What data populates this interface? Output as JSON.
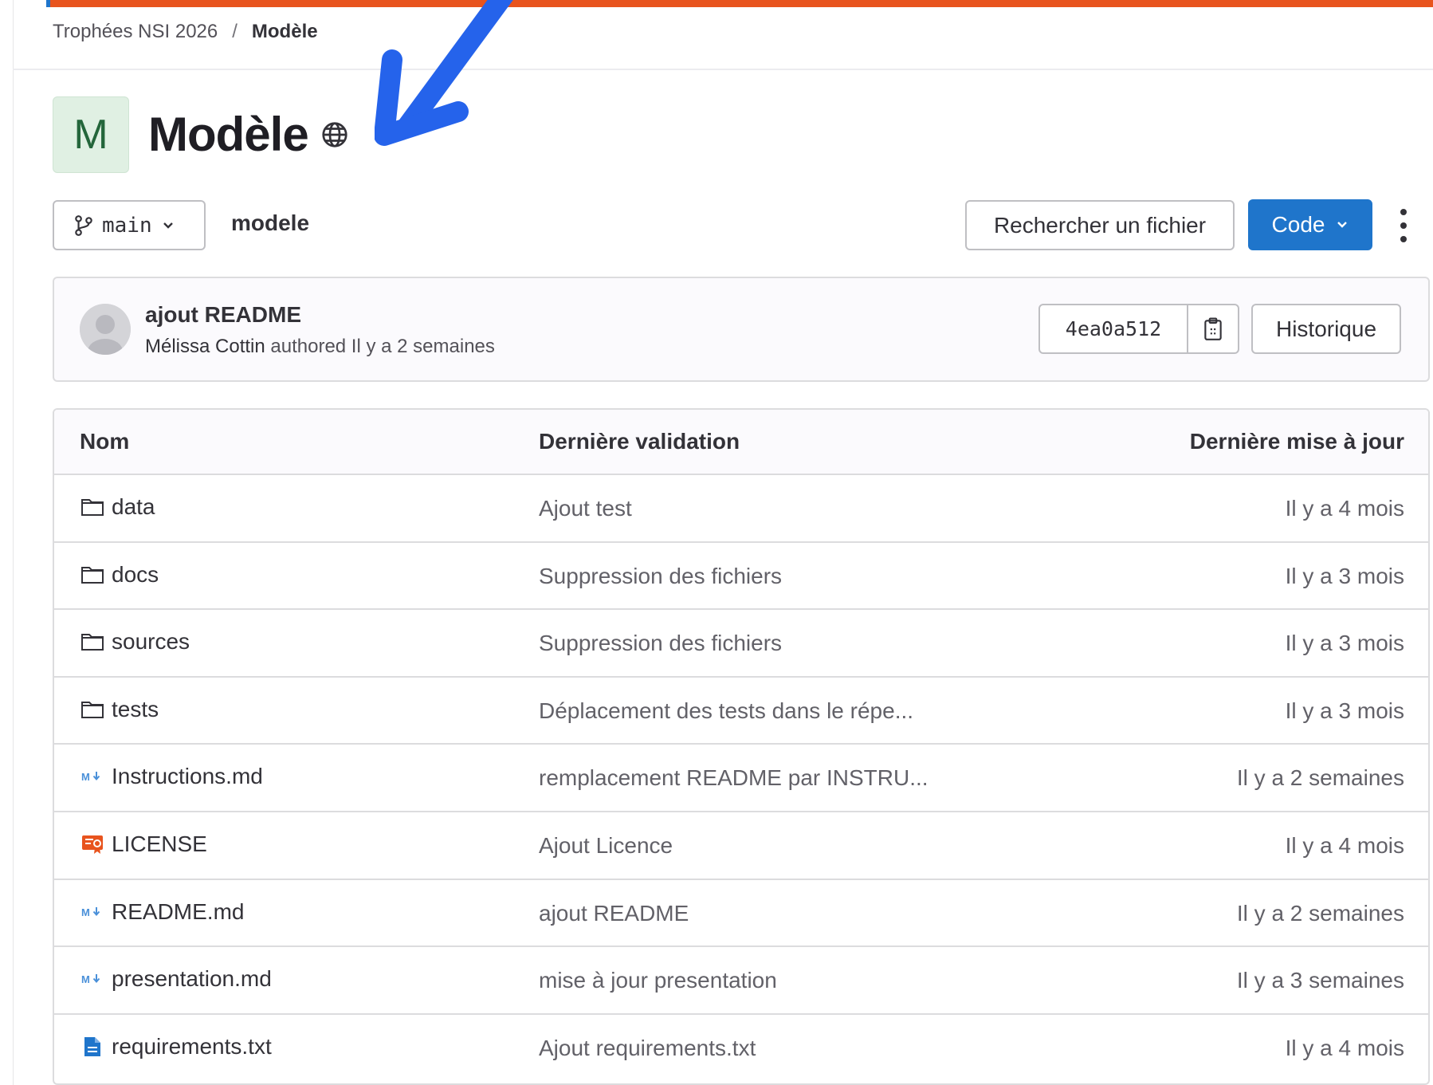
{
  "breadcrumb": {
    "group": "Trophées NSI 2026",
    "separator": "/",
    "current": "Modèle"
  },
  "project": {
    "avatar_letter": "M",
    "title": "Modèle",
    "visibility_icon": "globe-icon"
  },
  "toolbar": {
    "branch": "main",
    "repo_name": "modele",
    "find_file": "Rechercher un fichier",
    "code": "Code"
  },
  "last_commit": {
    "title": "ajout README",
    "author": "Mélissa Cottin",
    "meta": " authored Il y a 2 semaines",
    "sha": "4ea0a512",
    "history": "Historique"
  },
  "table": {
    "headers": {
      "name": "Nom",
      "commit": "Dernière validation",
      "date": "Dernière mise à jour"
    },
    "rows": [
      {
        "icon": "folder-icon",
        "name": "data",
        "commit": "Ajout test",
        "date": "Il y a 4 mois"
      },
      {
        "icon": "folder-icon",
        "name": "docs",
        "commit": "Suppression des fichiers",
        "date": "Il y a 3 mois"
      },
      {
        "icon": "folder-icon",
        "name": "sources",
        "commit": "Suppression des fichiers",
        "date": "Il y a 3 mois"
      },
      {
        "icon": "folder-icon",
        "name": "tests",
        "commit": "Déplacement des tests dans le répe...",
        "date": "Il y a 3 mois"
      },
      {
        "icon": "markdown-icon",
        "name": "Instructions.md",
        "commit": "remplacement README par INSTRU...",
        "date": "Il y a 2 semaines"
      },
      {
        "icon": "license-icon",
        "name": "LICENSE",
        "commit": "Ajout Licence",
        "date": "Il y a 4 mois"
      },
      {
        "icon": "markdown-icon",
        "name": "README.md",
        "commit": "ajout README",
        "date": "Il y a 2 semaines"
      },
      {
        "icon": "markdown-icon",
        "name": "presentation.md",
        "commit": "mise à jour presentation",
        "date": "Il y a 3 semaines"
      },
      {
        "icon": "text-file-icon",
        "name": "requirements.txt",
        "commit": "Ajout requirements.txt",
        "date": "Il y a 4 mois"
      }
    ]
  },
  "colors": {
    "accent": "#1f75cb",
    "top_bar": "#e8541e",
    "annotation_arrow": "#2563eb",
    "avatar_bg": "#e0f0e3"
  }
}
